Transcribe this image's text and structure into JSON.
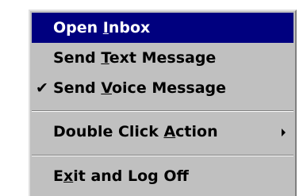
{
  "menu": {
    "items": [
      {
        "label_before": "Open ",
        "mnemonic": "I",
        "label_after": "nbox",
        "selected": true,
        "checked": false,
        "has_submenu": false
      },
      {
        "label_before": "Send ",
        "mnemonic": "T",
        "label_after": "ext Message",
        "selected": false,
        "checked": false,
        "has_submenu": false
      },
      {
        "label_before": "Send ",
        "mnemonic": "V",
        "label_after": "oice Message",
        "selected": false,
        "checked": true,
        "has_submenu": false
      },
      {
        "label_before": "Double Click ",
        "mnemonic": "A",
        "label_after": "ction",
        "selected": false,
        "checked": false,
        "has_submenu": true
      },
      {
        "label_before": "E",
        "mnemonic": "x",
        "label_after": "it and Log Off",
        "selected": false,
        "checked": false,
        "has_submenu": false
      }
    ],
    "check_glyph": "✔",
    "colors": {
      "menu_bg": "#c0c0c0",
      "highlight_bg": "#00007f",
      "highlight_text": "#ffffff",
      "text": "#000000"
    },
    "icons": {
      "check": "checkmark-icon",
      "submenu": "submenu-arrow-icon"
    }
  }
}
